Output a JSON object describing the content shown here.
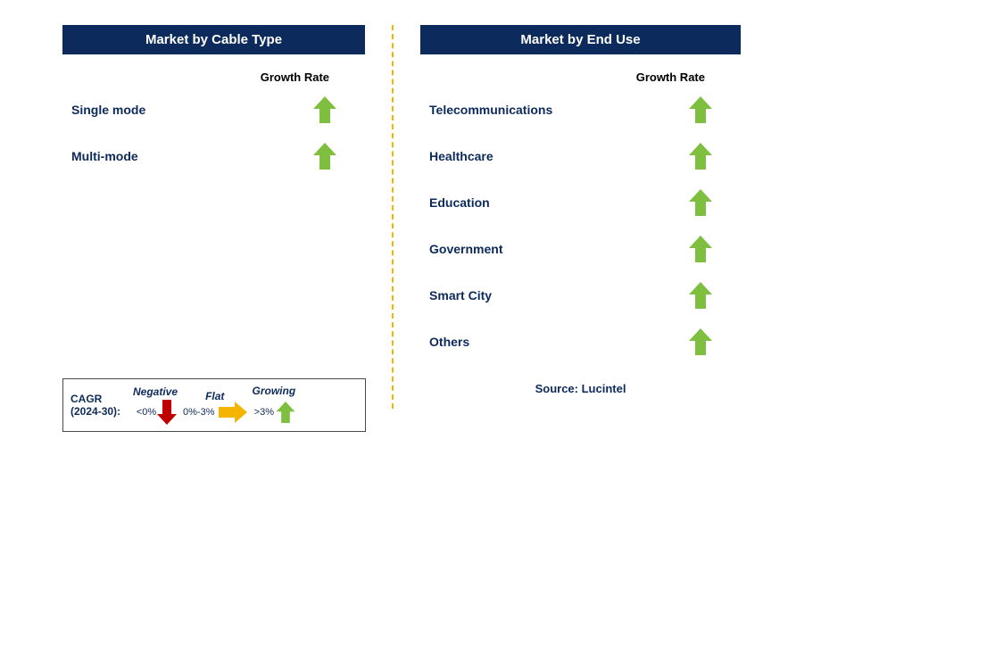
{
  "left": {
    "title": "Market by Cable Type",
    "growth_header": "Growth Rate",
    "items": [
      {
        "label": "Single mode",
        "trend": "growing"
      },
      {
        "label": "Multi-mode",
        "trend": "growing"
      }
    ]
  },
  "right": {
    "title": "Market by End Use",
    "growth_header": "Growth Rate",
    "items": [
      {
        "label": "Telecommunications",
        "trend": "growing"
      },
      {
        "label": "Healthcare",
        "trend": "growing"
      },
      {
        "label": "Education",
        "trend": "growing"
      },
      {
        "label": "Government",
        "trend": "growing"
      },
      {
        "label": "Smart City",
        "trend": "growing"
      },
      {
        "label": "Others",
        "trend": "growing"
      }
    ]
  },
  "legend": {
    "period_label": "CAGR",
    "period_range": "(2024-30):",
    "negative": {
      "tag": "Negative",
      "range": "<0%"
    },
    "flat": {
      "tag": "Flat",
      "range": "0%-3%"
    },
    "growing": {
      "tag": "Growing",
      "range": ">3%"
    }
  },
  "source": "Source: Lucintel"
}
